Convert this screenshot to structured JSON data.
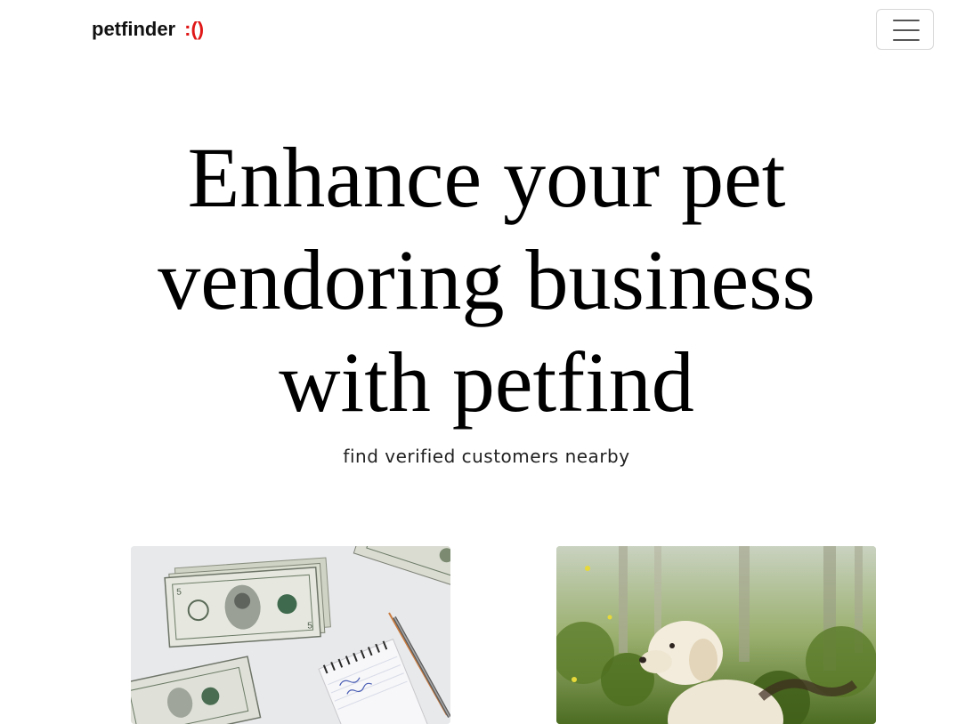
{
  "navbar": {
    "brand": "petfinder",
    "brand_emoticon": ":()",
    "brand_emoticon_color": "#e01818",
    "menu_icon": "hamburger-icon"
  },
  "hero": {
    "title_lines": [
      "Enhance your pet",
      "vendoring business",
      "with petfind"
    ],
    "subtitle": "find verified customers nearby"
  },
  "cards": [
    {
      "image": "money-and-notepad-photo"
    },
    {
      "image": "puppy-photo"
    }
  ]
}
